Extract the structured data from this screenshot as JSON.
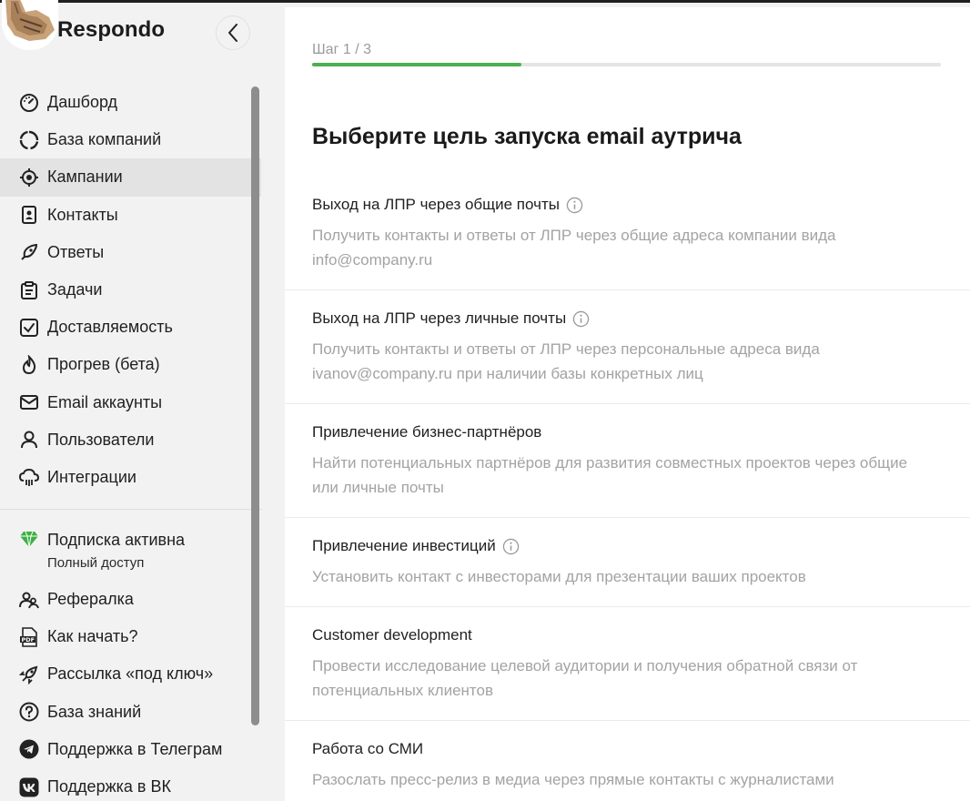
{
  "brand": {
    "name": "Respondo"
  },
  "sidebar": {
    "items": [
      {
        "label": "Дашборд",
        "icon": "speedometer-icon"
      },
      {
        "label": "База компаний",
        "icon": "circle-segments-icon"
      },
      {
        "label": "Кампании",
        "icon": "target-icon",
        "active": true
      },
      {
        "label": "Контакты",
        "icon": "contact-book-icon"
      },
      {
        "label": "Ответы",
        "icon": "rocket-reply-icon"
      },
      {
        "label": "Задачи",
        "icon": "clipboard-icon"
      },
      {
        "label": "Доставляемость",
        "icon": "checkbox-icon"
      },
      {
        "label": "Прогрев (бета)",
        "icon": "flame-icon"
      },
      {
        "label": "Email аккаунты",
        "icon": "envelope-icon"
      },
      {
        "label": "Пользователи",
        "icon": "user-icon"
      },
      {
        "label": "Интеграции",
        "icon": "cloud-icon"
      }
    ],
    "subscription": {
      "title": "Подписка активна",
      "subtitle": "Полный доступ",
      "icon": "diamond-icon",
      "color": "#3cb043"
    },
    "bottom_items": [
      {
        "label": "Рефералка",
        "icon": "users-icon"
      },
      {
        "label": "Как начать?",
        "icon": "pdf-icon"
      },
      {
        "label": "Рассылка «под ключ»",
        "icon": "rocket-icon"
      },
      {
        "label": "База знаний",
        "icon": "question-icon"
      },
      {
        "label": "Поддержка в Телеграм",
        "icon": "telegram-icon"
      },
      {
        "label": "Поддержка в ВК",
        "icon": "vk-icon"
      }
    ]
  },
  "main": {
    "step": "Шаг 1 / 3",
    "progress_fraction": 0.333,
    "heading": "Выберите цель запуска email аутрича",
    "goals": [
      {
        "title": "Выход на ЛПР через общие почты",
        "info": true,
        "desc": "Получить контакты и ответы от ЛПР через общие адреса компании вида info@company.ru"
      },
      {
        "title": "Выход на ЛПР через личные почты",
        "info": true,
        "desc": "Получить контакты и ответы от ЛПР через персональные адреса вида ivanov@company.ru при наличии базы конкретных лиц"
      },
      {
        "title": "Привлечение бизнес-партнёров",
        "info": false,
        "desc": "Найти потенциальных партнёров для развития совместных проектов через общие или личные почты"
      },
      {
        "title": "Привлечение инвестиций",
        "info": true,
        "desc": "Установить контакт с инвесторами для презентации ваших проектов"
      },
      {
        "title": "Customer development",
        "info": false,
        "desc": "Провести исследование целевой аудитории и получения обратной связи от потенциальных клиентов"
      },
      {
        "title": "Работа со СМИ",
        "info": false,
        "desc": "Разослать пресс-релиз в медиа через прямые контакты с журналистами"
      }
    ]
  },
  "colors": {
    "accent": "#4caf50",
    "active_bg": "#e3e3e3"
  }
}
